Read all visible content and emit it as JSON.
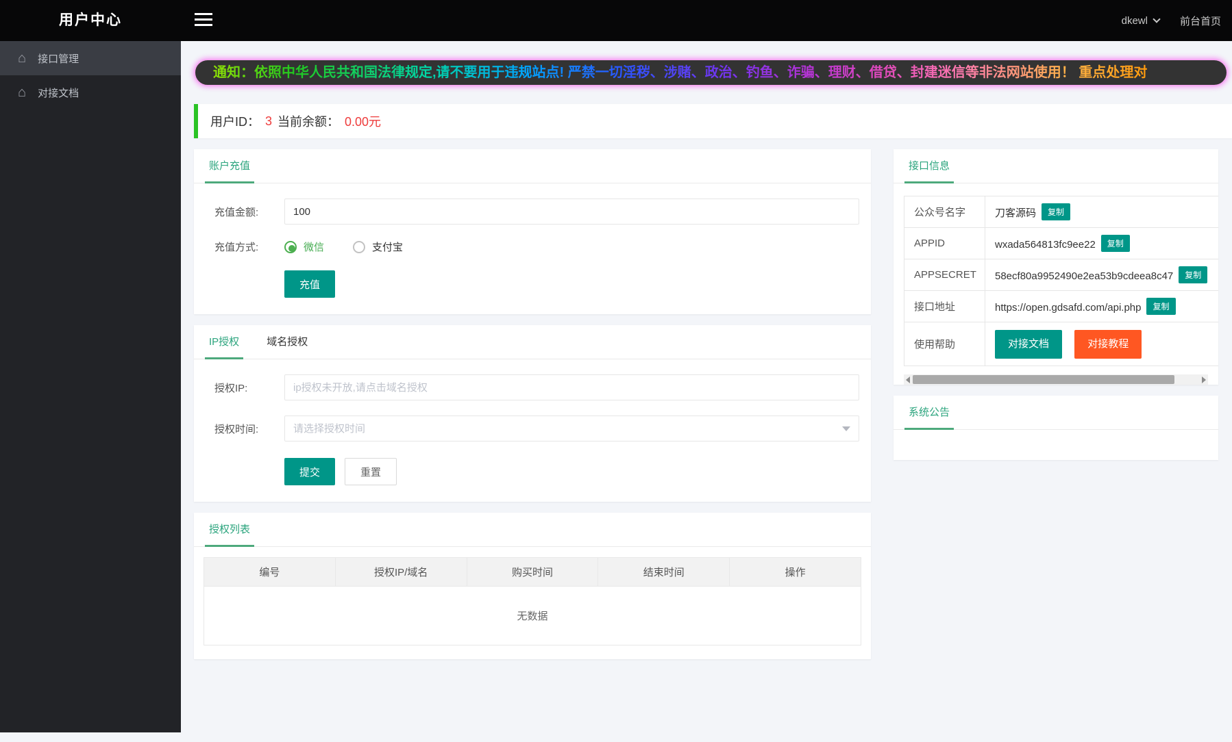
{
  "topbar": {
    "logo": "用户中心",
    "username": "dkewl",
    "home_link": "前台首页"
  },
  "sidebar": {
    "items": [
      {
        "label": "接口管理"
      },
      {
        "label": "对接文档"
      }
    ]
  },
  "notice": {
    "text": "通知：依照中华人民共和国法律规定,请不要用于违规站点! 严禁一切淫秽、涉赌、政治、钓鱼、诈骗、理财、借贷、封建迷信等非法网站使用！ 重点处理对"
  },
  "user_info": {
    "id_label": "用户ID：",
    "id_value": "3",
    "balance_label": "当前余额：",
    "balance_value": "0.00元"
  },
  "recharge": {
    "title": "账户充值",
    "amount_label": "充值金额:",
    "amount_value": "100",
    "method_label": "充值方式:",
    "methods": [
      {
        "label": "微信",
        "checked": true
      },
      {
        "label": "支付宝",
        "checked": false
      }
    ],
    "submit_label": "充值"
  },
  "auth": {
    "tabs": [
      {
        "label": "IP授权",
        "active": true
      },
      {
        "label": "域名授权",
        "active": false
      }
    ],
    "ip_label": "授权IP:",
    "ip_placeholder": "ip授权未开放,请点击域名授权",
    "time_label": "授权时间:",
    "time_placeholder": "请选择授权时间",
    "submit_label": "提交",
    "reset_label": "重置"
  },
  "auth_list": {
    "title": "授权列表",
    "columns": [
      "编号",
      "授权IP/域名",
      "购买时间",
      "结束时间",
      "操作"
    ],
    "empty_text": "无数据"
  },
  "api_info": {
    "title": "接口信息",
    "copy_label": "复制",
    "rows": [
      {
        "label": "公众号名字",
        "value": "刀客源码"
      },
      {
        "label": "APPID",
        "value": "wxada564813fc9ee22"
      },
      {
        "label": "APPSECRET",
        "value": "58ecf80a9952490e2ea53b9cdeea8c47"
      },
      {
        "label": "接口地址",
        "value": "https://open.gdsafd.com/api.php"
      }
    ],
    "help_label": "使用帮助",
    "help_buttons": [
      {
        "label": "对接文档",
        "color": "#009688"
      },
      {
        "label": "对接教程",
        "color": "#ff5722"
      }
    ]
  },
  "announcement": {
    "title": "系统公告"
  },
  "colors": {
    "accent_teal": "#009688",
    "title_green": "#2ba47d",
    "tab_underline": "#4da97c",
    "radio_green": "#4caf50",
    "orange": "#ff5722",
    "red": "#ee3b3b",
    "userbar_green": "#2ac325",
    "notice_border_pink": "#f5aaf2",
    "topbar_bg": "#070708",
    "sidebar_bg": "#222327"
  }
}
